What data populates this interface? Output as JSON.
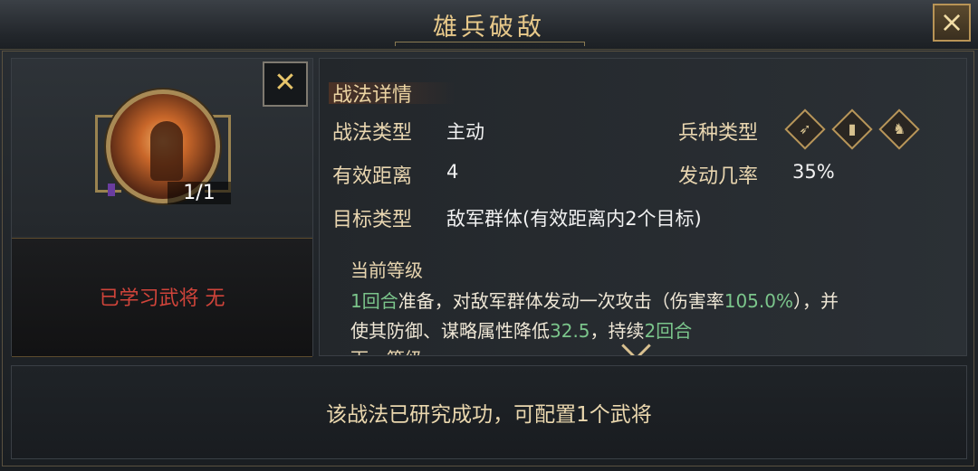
{
  "window": {
    "title": "雄兵破敌",
    "close_icon": "×"
  },
  "left": {
    "count": "1/1",
    "learned_text": "已学习武将 无",
    "close_small": "✕"
  },
  "details": {
    "section_title": "战法详情",
    "type_label": "战法类型",
    "type_value": "主动",
    "range_label": "有效距离",
    "range_value": "4",
    "target_label": "目标类型",
    "target_value": "敌军群体(有效距离内2个目标)",
    "unit_label": "兵种类型",
    "unit_icons": [
      "bow-icon",
      "shield-icon",
      "horse-icon"
    ],
    "trigger_label": "发动几率",
    "trigger_value": "35%"
  },
  "level": {
    "title": "当前等级",
    "desc": {
      "p1": "1回合",
      "p2": "准备，对敌军群体发动一次攻击（伤害率",
      "p3": "105.0%",
      "p4": "），并",
      "p5": "使其防御、谋略属性降低",
      "p6": "32.5",
      "p7": "，持续",
      "p8": "2回合"
    },
    "next_title": "下一等级"
  },
  "bottom": {
    "text": "该战法已研究成功，可配置1个武将"
  },
  "colors": {
    "accent": "#e8c98a",
    "highlight": "#7bc58b",
    "warning": "#d0443a"
  }
}
